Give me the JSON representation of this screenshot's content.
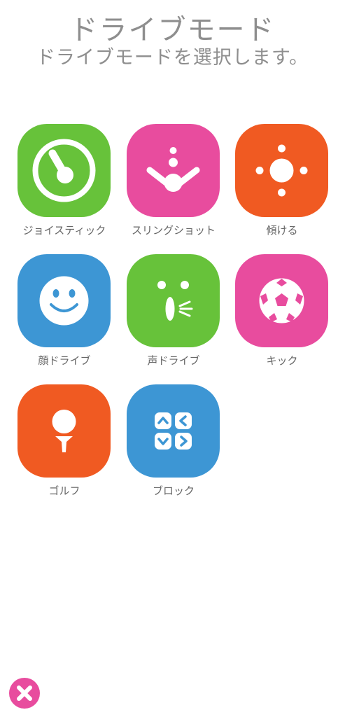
{
  "header": {
    "title": "ドライブモード",
    "subtitle": "ドライブモードを選択します。"
  },
  "modes": [
    {
      "label": "ジョイスティック",
      "color": "#67c23a",
      "icon": "joystick-icon"
    },
    {
      "label": "スリングショット",
      "color": "#e84c9e",
      "icon": "slingshot-icon"
    },
    {
      "label": "傾ける",
      "color": "#f05a22",
      "icon": "tilt-icon"
    },
    {
      "label": "顔ドライブ",
      "color": "#3d96d4",
      "icon": "smiley-face-icon"
    },
    {
      "label": "声ドライブ",
      "color": "#67c23a",
      "icon": "voice-face-icon"
    },
    {
      "label": "キック",
      "color": "#e84c9e",
      "icon": "soccer-ball-icon"
    },
    {
      "label": "ゴルフ",
      "color": "#f05a22",
      "icon": "golf-ball-on-tee-icon"
    },
    {
      "label": "ブロック",
      "color": "#3d96d4",
      "icon": "arrow-blocks-icon"
    }
  ],
  "close": {
    "icon": "close-icon",
    "color": "#e84c9e"
  }
}
